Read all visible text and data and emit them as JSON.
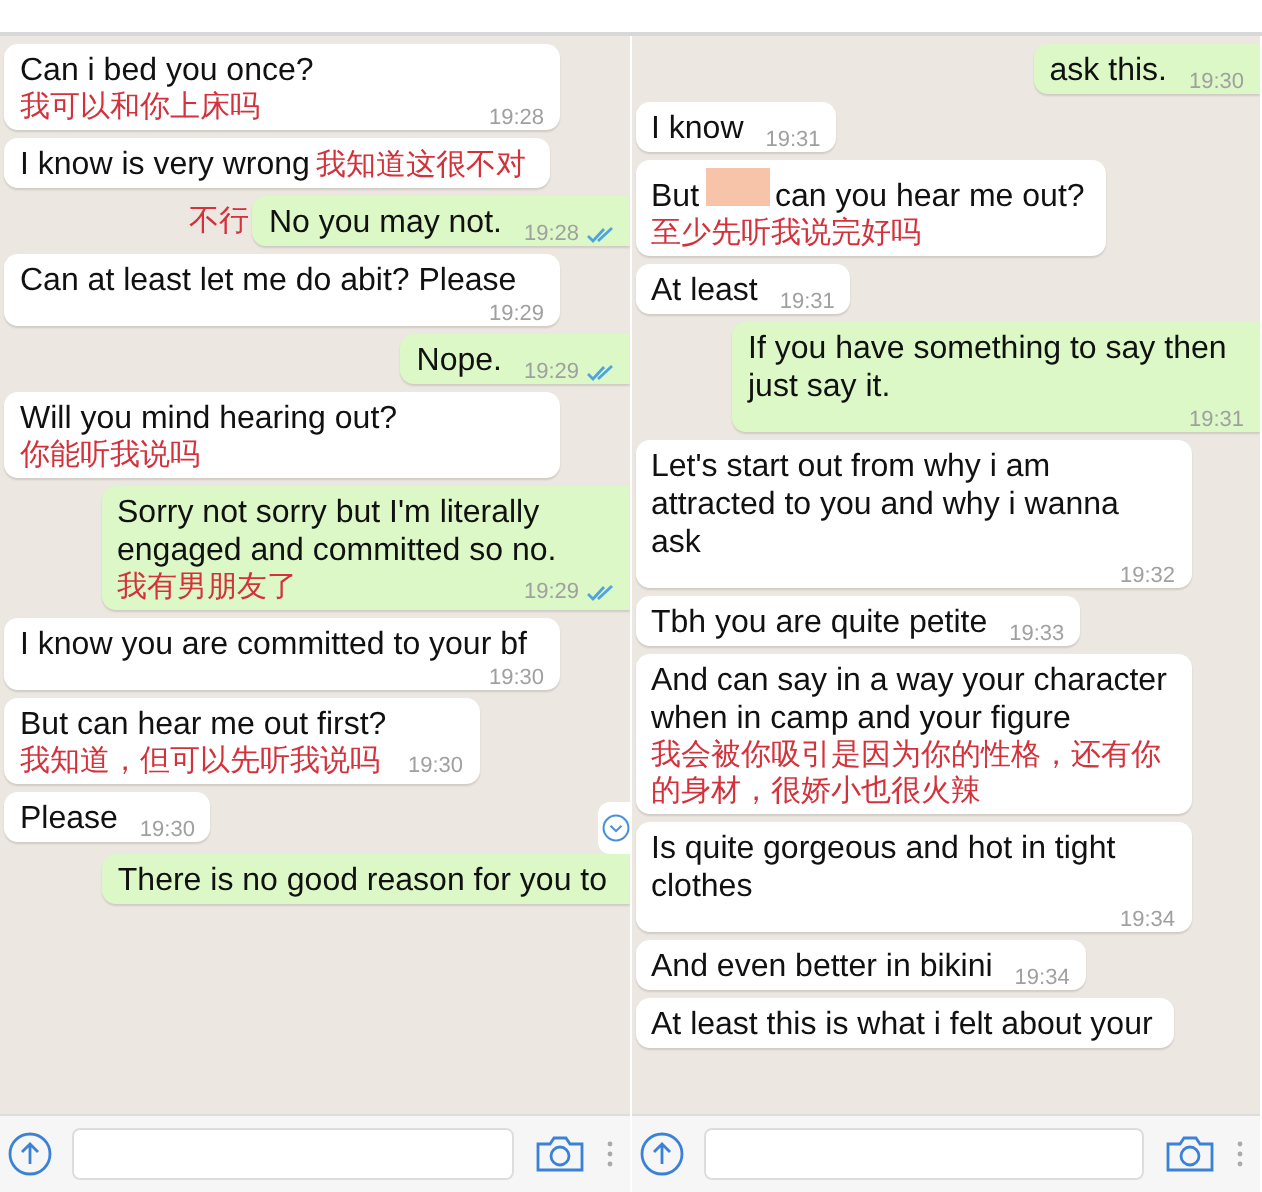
{
  "panels": [
    {
      "messages": [
        {
          "outgoing": false,
          "text": "Can i bed you once?",
          "time": "19:28",
          "note_after": "我可以和你上床吗"
        },
        {
          "outgoing": false,
          "text": "I know is very wrong",
          "note_after": "我知道这很不对"
        },
        {
          "outgoing": true,
          "text": "No you may not.",
          "time": "19:28",
          "read": true,
          "note_before": "不行"
        },
        {
          "outgoing": false,
          "text": "Can at least let me do abit? Please",
          "time": "19:29"
        },
        {
          "outgoing": true,
          "text": "Nope.",
          "time": "19:29",
          "read": true
        },
        {
          "outgoing": false,
          "text": "Will you mind hearing out?",
          "note_after": "你能听我说吗"
        },
        {
          "outgoing": true,
          "text": "Sorry not sorry but I'm literally engaged and committed so no.",
          "time": "19:29",
          "read": true,
          "note_below": "我有男朋友了"
        },
        {
          "outgoing": false,
          "text": "I know you are committed to your bf",
          "time": "19:30"
        },
        {
          "outgoing": false,
          "text": "But can hear me out first?",
          "time": "19:30",
          "note_below": "我知道，但可以先听我说吗"
        },
        {
          "outgoing": false,
          "text": "Please",
          "time": "19:30"
        },
        {
          "outgoing": true,
          "text": "There is no good reason for you to"
        }
      ]
    },
    {
      "messages": [
        {
          "outgoing": true,
          "text": "ask this.",
          "time": "19:30"
        },
        {
          "outgoing": false,
          "text": "I know",
          "time": "19:31"
        },
        {
          "outgoing": false,
          "text": "But",
          "text_after": "can you hear me out?",
          "note_below": "至少先听我说完好吗"
        },
        {
          "outgoing": false,
          "text": "At least",
          "time": "19:31"
        },
        {
          "outgoing": true,
          "text": "If you have something to say then just say it.",
          "time": "19:31"
        },
        {
          "outgoing": false,
          "text": "Let's start out from why i am attracted to you and why i wanna ask",
          "time": "19:32"
        },
        {
          "outgoing": false,
          "text": "Tbh you are quite petite",
          "time": "19:33"
        },
        {
          "outgoing": false,
          "text": "And can say in a way your character when in camp and your figure",
          "note_below": "我会被你吸引是因为你的性格，还有你的身材，很娇小也很火辣"
        },
        {
          "outgoing": false,
          "text": "Is quite gorgeous and hot in tight clothes",
          "time": "19:34"
        },
        {
          "outgoing": false,
          "text": "And even better in bikini",
          "time": "19:34"
        },
        {
          "outgoing": false,
          "text": "At least this is what i felt about your"
        }
      ]
    }
  ]
}
